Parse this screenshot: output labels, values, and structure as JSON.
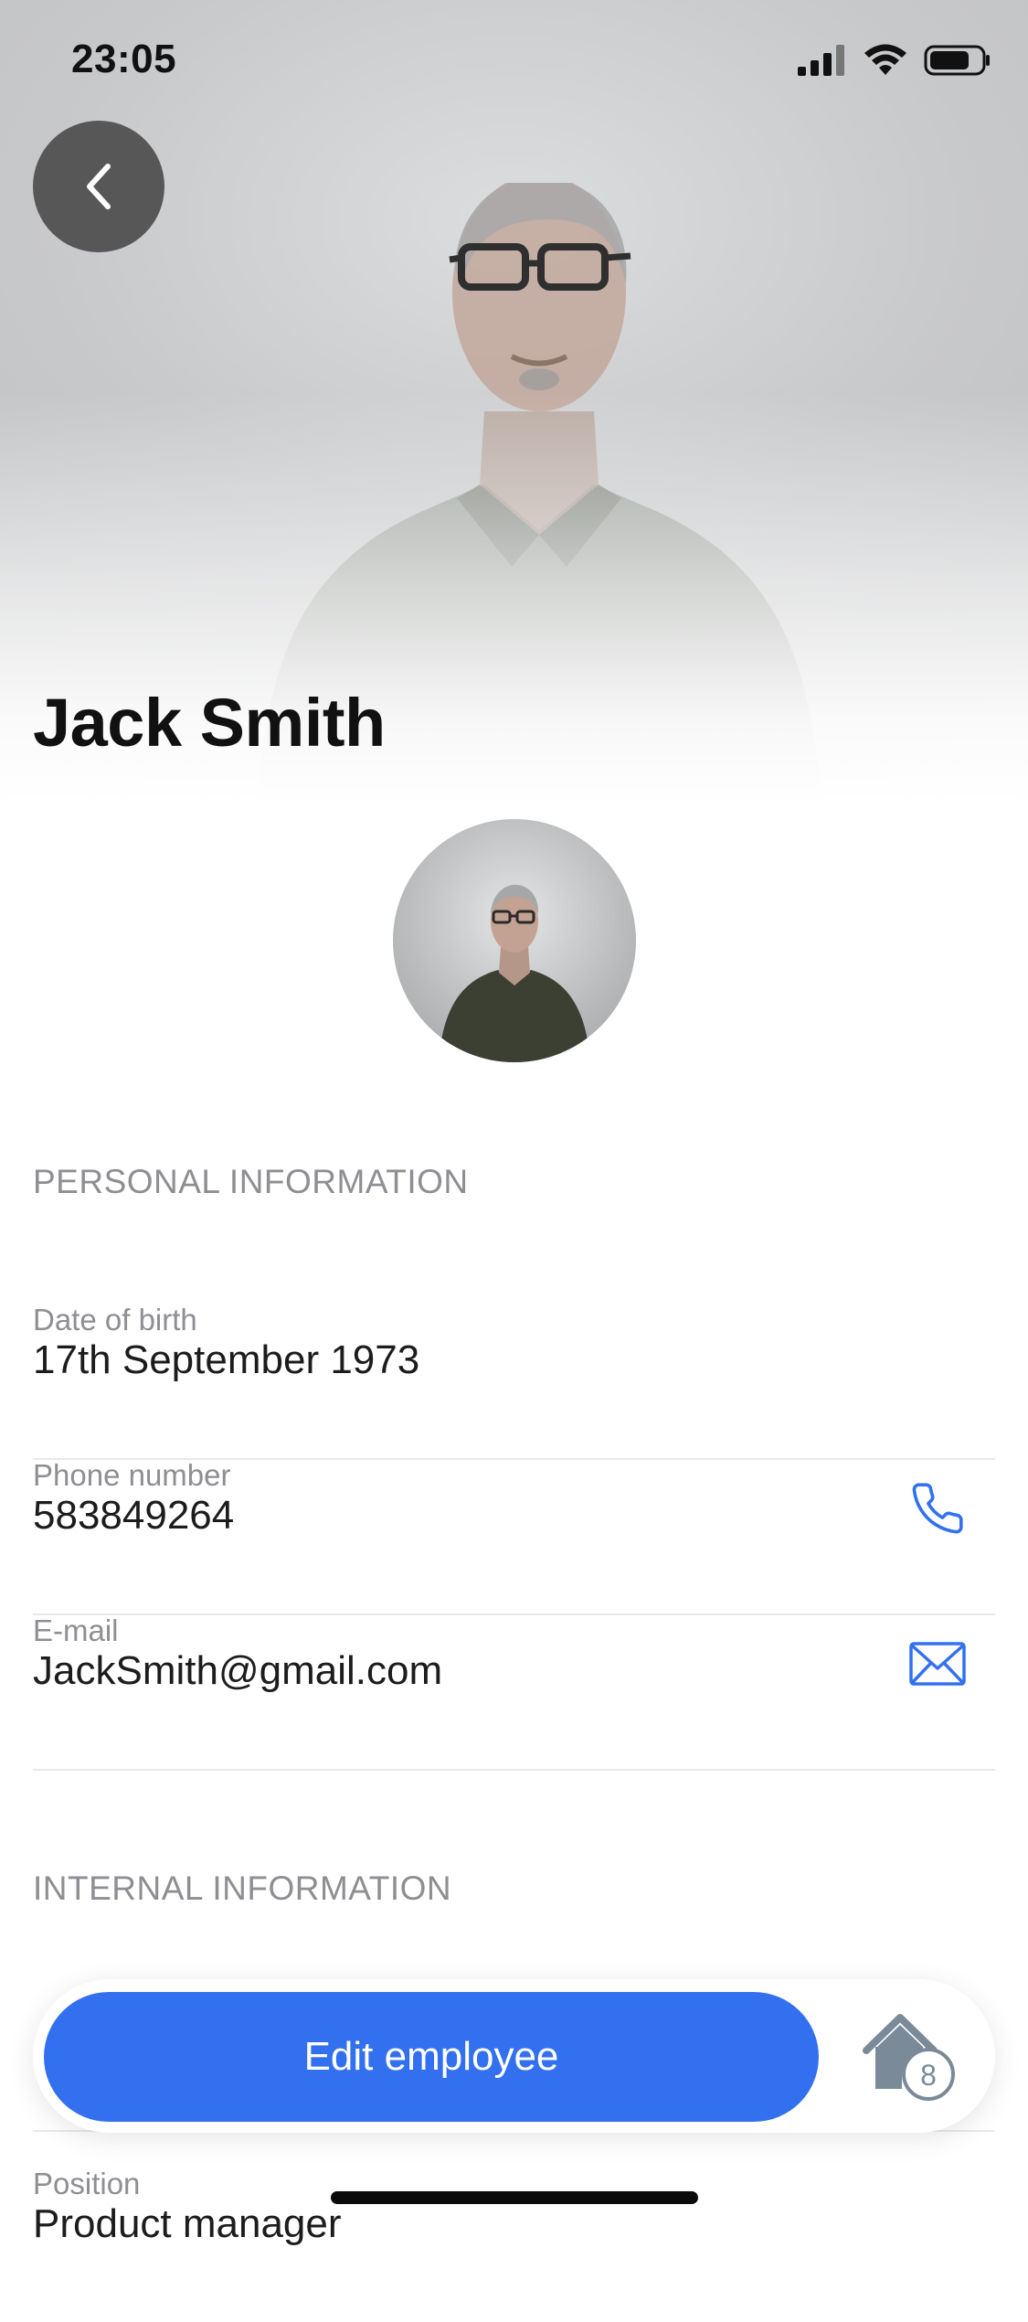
{
  "status_bar": {
    "time": "23:05",
    "signal_icon": "cellular-signal-icon",
    "wifi_icon": "wifi-icon",
    "battery_icon": "battery-icon"
  },
  "header": {
    "back_icon": "chevron-left-icon",
    "name": "Jack Smith"
  },
  "personal": {
    "title": "PERSONAL INFORMATION",
    "fields": [
      {
        "label": "Date of birth",
        "value": "17th September 1973"
      },
      {
        "label": "Phone number",
        "value": "583849264",
        "action_icon": "phone-icon"
      },
      {
        "label": "E-mail",
        "value": "JackSmith@gmail.com",
        "action_icon": "mail-icon"
      }
    ]
  },
  "internal": {
    "title": "INTERNAL INFORMATION",
    "fields": [
      {
        "label": "Position",
        "value": "Product manager"
      }
    ]
  },
  "bottom_bar": {
    "edit_label": "Edit employee",
    "home_icon": "home-icon",
    "home_badge": "8"
  },
  "colors": {
    "accent": "#3370f0",
    "back_button": "#575757",
    "muted_text": "#8e8e93"
  }
}
